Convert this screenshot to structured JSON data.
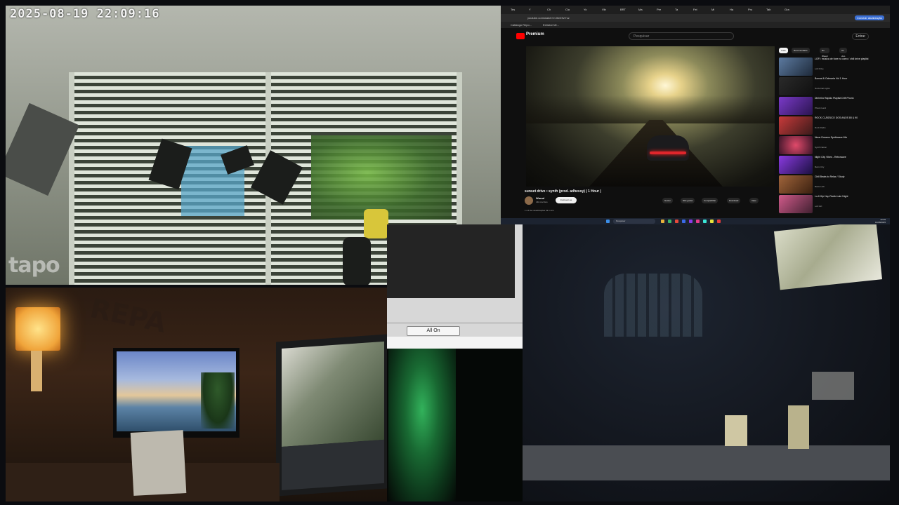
{
  "cam1": {
    "timestamp": "2025-08-19 22:09:16",
    "brand": "tapo"
  },
  "browser": {
    "tabs": [
      "Tes",
      "Y",
      "Ch",
      "Cla",
      "Yo",
      "Vib",
      "BRT",
      "Ma",
      "Pre",
      "Ta",
      "Fel",
      "Mi",
      "Ha",
      "Pro",
      "Tab",
      "Gra"
    ],
    "url": "youtube.com/watch?v=0kGSzYcz",
    "bookmarks": [
      "Catálogo Repo...",
      "Extrator Mr..."
    ],
    "update_button": "Concluir atualização"
  },
  "youtube": {
    "logo_text": "Premium",
    "search_placeholder": "Pesquisar",
    "signin": "Entrar",
    "video_title": "sunset drive • synth (prod. adhessy) | 1 Hour |",
    "channel": "Wuuul",
    "subscribers": "44k inscritos",
    "subscribe": "Inscrever-se",
    "actions": [
      "Gostei",
      "Não gostei",
      "Compartilhar",
      "Download",
      "Clipe"
    ],
    "meta": "1 mil de visualizações há 1 ano",
    "chips": [
      "Tudo",
      "Recomendado",
      "Do Wuuul",
      "Ao vivo"
    ],
    "recommendations": [
      {
        "title": "LOFI: música de fone no carro / chill drive playlist",
        "channel": "Lofi Drive"
      },
      {
        "title": "Bonsai & Calmaria Vol 1 Hour",
        "channel": "Nocturnal Lights"
      },
      {
        "title": "Dinheiro Rápido Playlist Drift Phonk",
        "channel": "Phonk Land"
      },
      {
        "title": "ROCK CLÁSSICO DOS ANOS 80 & 90",
        "channel": "Rock Radio"
      },
      {
        "title": "Neon Dreams Synthwave Mix",
        "channel": "Synth Nation"
      },
      {
        "title": "Night City Vibes - Retrowave",
        "channel": "Retro City"
      },
      {
        "title": "Chill Beats to Relax / Study",
        "channel": "Beats Hub"
      },
      {
        "title": "Lo-fi Hip Hop Radio Late Night",
        "channel": "Lofi Girl"
      }
    ],
    "taskbar_search": "Pesquisar",
    "clock_time": "22:09",
    "clock_date": "19/08/2025"
  },
  "app": {
    "all_on_label": "All On"
  },
  "office": {
    "wall_text": "REPA"
  },
  "colors": {
    "youtube_red": "#ff0000",
    "taillight": "#e0262c",
    "lamp": "#f0a43a",
    "glow": "#3ad06a"
  }
}
